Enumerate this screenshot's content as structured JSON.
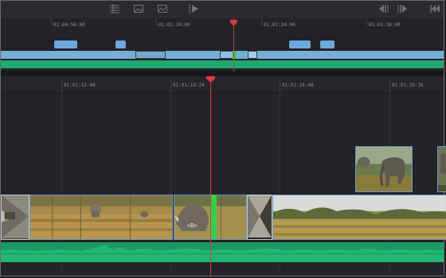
{
  "toolbar": {
    "left_icons": [
      "timeline-list-icon",
      "image-icon",
      "thumbnail-icon",
      "play-edit-icon"
    ],
    "right_icons": [
      "prev-edit-icon",
      "next-edit-icon",
      "go-to-start-icon"
    ]
  },
  "mini_timeline": {
    "timecodes": [
      "01:00:56:00",
      "01:01:10:00",
      "01:01:24:00",
      "01:01:38:00"
    ]
  },
  "main_timeline": {
    "timecodes": [
      "01:01:12:48",
      "01:01:18:24",
      "01:01:24:00",
      "01:01:29:36"
    ],
    "edit_marker": "<D>"
  },
  "colors": {
    "playhead": "#d13a3a",
    "video_clip_border": "#6b97c9",
    "audio_track": "#1a9a63",
    "edit_point": "#2fd24a"
  }
}
